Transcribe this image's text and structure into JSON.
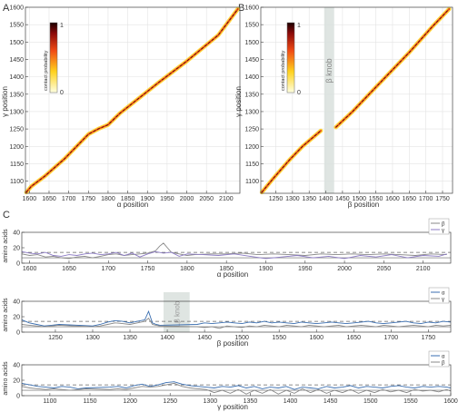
{
  "panel_labels": [
    "A",
    "B",
    "C"
  ],
  "chart_data": [
    {
      "type": "heatmap",
      "panel": "A",
      "xlabel": "α position",
      "ylabel": "γ position",
      "xlim": [
        1590,
        2135
      ],
      "ylim": [
        1065,
        1600
      ],
      "xticks": [
        1600,
        1650,
        1700,
        1750,
        1800,
        1850,
        1900,
        1950,
        2000,
        2050,
        2100
      ],
      "yticks": [
        1100,
        1150,
        1200,
        1250,
        1300,
        1350,
        1400,
        1450,
        1500,
        1550,
        1600
      ],
      "colorbar": {
        "label": "contact probability",
        "min_label": "0",
        "max_label": "1"
      },
      "diagonal": [
        [
          1592,
          1068
        ],
        [
          1605,
          1085
        ],
        [
          1640,
          1115
        ],
        [
          1690,
          1165
        ],
        [
          1720,
          1200
        ],
        [
          1750,
          1235
        ],
        [
          1775,
          1250
        ],
        [
          1800,
          1262
        ],
        [
          1830,
          1295
        ],
        [
          1880,
          1340
        ],
        [
          1930,
          1385
        ],
        [
          2000,
          1445
        ],
        [
          2080,
          1520
        ],
        [
          2130,
          1595
        ]
      ],
      "grid": true
    },
    {
      "type": "heatmap",
      "panel": "B",
      "xlabel": "β position",
      "ylabel": "γ position",
      "xlim": [
        1205,
        1780
      ],
      "ylim": [
        1065,
        1600
      ],
      "xticks": [
        1250,
        1300,
        1350,
        1400,
        1450,
        1500,
        1550,
        1600,
        1650,
        1700,
        1750
      ],
      "yticks": [
        1100,
        1150,
        1200,
        1250,
        1300,
        1350,
        1400,
        1450,
        1500,
        1550,
        1600
      ],
      "colorbar": {
        "label": "contact probability",
        "min_label": "0",
        "max_label": "1"
      },
      "shaded_region": {
        "x": [
          1395,
          1425
        ],
        "label": "β knob"
      },
      "diagonal_segments": [
        [
          [
            1208,
            1068
          ],
          [
            1240,
            1105
          ],
          [
            1290,
            1160
          ],
          [
            1330,
            1200
          ],
          [
            1385,
            1245
          ]
        ],
        [
          [
            1430,
            1255
          ],
          [
            1480,
            1300
          ],
          [
            1550,
            1370
          ],
          [
            1650,
            1470
          ],
          [
            1720,
            1545
          ],
          [
            1770,
            1595
          ]
        ]
      ],
      "grid": true
    },
    {
      "type": "line",
      "panel": "C1",
      "xlabel": "α position",
      "ylabel": "amino acids",
      "xlim": [
        1590,
        2135
      ],
      "ylim": [
        0,
        40
      ],
      "xticks": [
        1600,
        1650,
        1700,
        1750,
        1800,
        1850,
        1900,
        1950,
        2000,
        2050,
        2100
      ],
      "yticks": [
        0,
        20,
        40
      ],
      "threshold_dashed": 14,
      "threshold_solid": 7,
      "legend": [
        "β",
        "γ"
      ],
      "series": [
        {
          "name": "β",
          "color": "#888888",
          "x": [
            1590,
            1600,
            1610,
            1620,
            1630,
            1640,
            1650,
            1660,
            1670,
            1680,
            1690,
            1700,
            1710,
            1720,
            1730,
            1740,
            1750,
            1760,
            1765,
            1770,
            1775,
            1780,
            1790,
            1800,
            1810,
            1830,
            1850,
            1870,
            1890,
            1910,
            1930,
            1950,
            1970,
            1990,
            2010,
            2030,
            2050,
            2070,
            2090,
            2110,
            2130
          ],
          "y": [
            12,
            10,
            11,
            8,
            9,
            7,
            6,
            8,
            9,
            7,
            9,
            11,
            12,
            10,
            11,
            12,
            13,
            16,
            22,
            26,
            20,
            14,
            12,
            10,
            11,
            12,
            12,
            13,
            11,
            12,
            11,
            10,
            12,
            11,
            12,
            11,
            12,
            11,
            10,
            12,
            11
          ]
        },
        {
          "name": "γ",
          "color": "#8c7bc4",
          "x": [
            1590,
            1600,
            1610,
            1620,
            1630,
            1640,
            1650,
            1660,
            1670,
            1680,
            1690,
            1700,
            1710,
            1720,
            1730,
            1740,
            1750,
            1760,
            1770,
            1780,
            1790,
            1800,
            1820,
            1840,
            1860,
            1880,
            1900,
            1920,
            1940,
            1960,
            1980,
            2000,
            2020,
            2040,
            2060,
            2080,
            2100,
            2120,
            2130
          ],
          "y": [
            15,
            13,
            12,
            14,
            10,
            9,
            11,
            10,
            12,
            13,
            11,
            12,
            14,
            10,
            13,
            8,
            12,
            15,
            13,
            14,
            9,
            12,
            11,
            10,
            12,
            9,
            6,
            8,
            10,
            7,
            9,
            6,
            10,
            8,
            11,
            7,
            10,
            9,
            12
          ]
        }
      ]
    },
    {
      "type": "line",
      "panel": "C2",
      "xlabel": "β position",
      "ylabel": "amino acids",
      "xlim": [
        1205,
        1780
      ],
      "ylim": [
        0,
        40
      ],
      "xticks": [
        1250,
        1300,
        1350,
        1400,
        1450,
        1500,
        1550,
        1600,
        1650,
        1700,
        1750
      ],
      "yticks": [
        0,
        20,
        40
      ],
      "threshold_dashed": 14,
      "threshold_solid": 7,
      "shaded_region": {
        "x": [
          1395,
          1430
        ],
        "label": "Lβ knob"
      },
      "legend": [
        "α",
        "γ"
      ],
      "series": [
        {
          "name": "α",
          "color": "#3a6eb0",
          "x": [
            1205,
            1215,
            1225,
            1235,
            1245,
            1255,
            1300,
            1310,
            1320,
            1330,
            1340,
            1350,
            1360,
            1370,
            1375,
            1380,
            1385,
            1390,
            1440,
            1450,
            1460,
            1470,
            1480,
            1490,
            1500,
            1510,
            1520,
            1530,
            1540,
            1550,
            1560,
            1570,
            1580,
            1590,
            1600,
            1610,
            1620,
            1630,
            1640,
            1650,
            1660,
            1670,
            1680,
            1690,
            1700,
            1710,
            1720,
            1730,
            1740,
            1750,
            1760,
            1770,
            1780
          ],
          "y": [
            16,
            12,
            10,
            8,
            9,
            10,
            8,
            10,
            13,
            15,
            14,
            12,
            14,
            16,
            27,
            12,
            10,
            9,
            10,
            12,
            11,
            12,
            13,
            12,
            11,
            13,
            12,
            14,
            12,
            13,
            12,
            11,
            13,
            12,
            11,
            12,
            13,
            12,
            11,
            12,
            13,
            14,
            12,
            11,
            12,
            13,
            14,
            12,
            11,
            13,
            12,
            14,
            13
          ]
        },
        {
          "name": "γ",
          "color": "#888888",
          "x": [
            1205,
            1215,
            1225,
            1235,
            1245,
            1255,
            1300,
            1310,
            1320,
            1330,
            1340,
            1350,
            1360,
            1370,
            1375,
            1380,
            1385,
            1390,
            1440,
            1450,
            1460,
            1470,
            1480,
            1490,
            1500,
            1510,
            1520,
            1530,
            1540,
            1550,
            1560,
            1570,
            1580,
            1590,
            1600,
            1610,
            1620,
            1630,
            1640,
            1650,
            1660,
            1670,
            1680,
            1690,
            1700,
            1710,
            1720,
            1730,
            1740,
            1750,
            1760,
            1770,
            1780
          ],
          "y": [
            10,
            9,
            8,
            7,
            8,
            9,
            7,
            8,
            10,
            12,
            11,
            10,
            12,
            14,
            18,
            10,
            9,
            8,
            7,
            6,
            7,
            5,
            8,
            7,
            6,
            8,
            7,
            9,
            8,
            7,
            9,
            8,
            7,
            9,
            8,
            7,
            8,
            9,
            7,
            8,
            9,
            8,
            7,
            9,
            8,
            7,
            8,
            9,
            8,
            7,
            9,
            8,
            9
          ]
        }
      ]
    },
    {
      "type": "line",
      "panel": "C3",
      "xlabel": "γ position",
      "ylabel": "amino acids",
      "xlim": [
        1065,
        1600
      ],
      "ylim": [
        0,
        40
      ],
      "xticks": [
        1100,
        1150,
        1200,
        1250,
        1300,
        1350,
        1400,
        1450,
        1500,
        1550,
        1600
      ],
      "yticks": [
        0,
        20,
        40
      ],
      "threshold_dashed": 14,
      "threshold_solid": 7,
      "legend": [
        "α",
        "β"
      ],
      "series": [
        {
          "name": "α",
          "color": "#3a6eb0",
          "x": [
            1065,
            1075,
            1085,
            1095,
            1105,
            1115,
            1125,
            1135,
            1145,
            1175,
            1185,
            1195,
            1205,
            1215,
            1225,
            1235,
            1245,
            1255,
            1265,
            1275,
            1285,
            1295,
            1305,
            1315,
            1325,
            1335,
            1345,
            1355,
            1365,
            1375,
            1385,
            1395,
            1405,
            1415,
            1425,
            1435,
            1445,
            1455,
            1465,
            1475,
            1485,
            1495,
            1505,
            1515,
            1525,
            1535,
            1545,
            1555,
            1565,
            1575,
            1585,
            1595,
            1600
          ],
          "y": [
            16,
            14,
            12,
            11,
            10,
            12,
            11,
            9,
            10,
            11,
            12,
            10,
            13,
            15,
            12,
            14,
            17,
            18,
            15,
            13,
            12,
            11,
            10,
            12,
            11,
            13,
            10,
            12,
            9,
            11,
            10,
            12,
            8,
            11,
            10,
            9,
            12,
            10,
            11,
            13,
            10,
            12,
            11,
            10,
            12,
            13,
            11,
            10,
            12,
            11,
            12,
            11,
            10
          ]
        },
        {
          "name": "β",
          "color": "#888888",
          "x": [
            1065,
            1075,
            1085,
            1095,
            1105,
            1115,
            1125,
            1135,
            1145,
            1175,
            1185,
            1195,
            1205,
            1215,
            1225,
            1235,
            1245,
            1255,
            1265,
            1275,
            1285,
            1295,
            1305,
            1315,
            1325,
            1335,
            1345,
            1355,
            1365,
            1375,
            1385,
            1395,
            1405,
            1415,
            1425,
            1435,
            1445,
            1455,
            1465,
            1475,
            1485,
            1495,
            1505,
            1515,
            1525,
            1535,
            1545,
            1555,
            1565,
            1575,
            1585,
            1595,
            1600
          ],
          "y": [
            12,
            10,
            9,
            8,
            9,
            8,
            7,
            8,
            9,
            8,
            9,
            8,
            10,
            12,
            11,
            12,
            14,
            16,
            12,
            10,
            9,
            8,
            4,
            7,
            3,
            8,
            2,
            7,
            3,
            8,
            2,
            7,
            3,
            9,
            4,
            8,
            3,
            7,
            4,
            8,
            3,
            7,
            4,
            8,
            5,
            7,
            4,
            8,
            6,
            7,
            5,
            8,
            6
          ]
        }
      ]
    }
  ]
}
